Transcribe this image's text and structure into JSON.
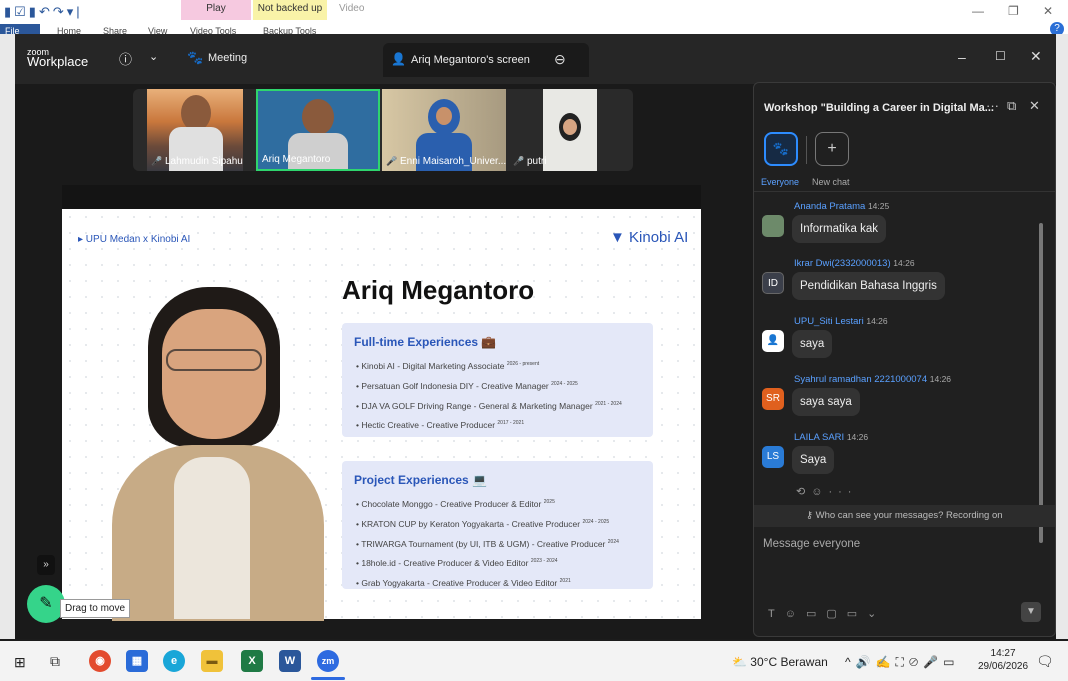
{
  "ribbon": {
    "tab_play": "Play",
    "tab_not_backed_up": "Not backed up",
    "tab_video": "Video",
    "tab_file": "File",
    "tab_home": "Home",
    "tab_share": "Share",
    "tab_view": "View",
    "tab_video_tools": "Video Tools",
    "tab_backup_tools": "Backup Tools"
  },
  "zoom": {
    "logo_small": "zoom",
    "logo_big": "Workplace",
    "meeting_label": "Meeting",
    "share_tab_label": "Ariq Megantoro's screen"
  },
  "participants": [
    {
      "name": "Lahmudin Sipahutar ..."
    },
    {
      "name": "Ariq Megantoro"
    },
    {
      "name": "Enni Maisaroh_Univer..."
    },
    {
      "name": "putri"
    }
  ],
  "slide": {
    "breadcrumb": "▸ UPU Medan x Kinobi AI",
    "brand": "Kinobi AI",
    "name": "Ariq Megantoro",
    "fulltime_title": "Full-time Experiences 💼",
    "fulltime_items": [
      {
        "text": "Kinobi AI - Digital Marketing Associate",
        "period": "2026 - present"
      },
      {
        "text": "Persatuan Golf Indonesia DIY - Creative Manager",
        "period": "2024 - 2025"
      },
      {
        "text": "DJA VA GOLF Driving Range - General & Marketing Manager",
        "period": "2021 - 2024"
      },
      {
        "text": "Hectic Creative - Creative Producer",
        "period": "2017 - 2021"
      }
    ],
    "project_title": "Project Experiences 💻",
    "project_items": [
      {
        "text": "Chocolate Monggo - Creative Producer & Editor",
        "period": "2025"
      },
      {
        "text": "KRATON CUP by Keraton Yogyakarta - Creative Producer",
        "period": "2024 - 2025"
      },
      {
        "text": "TRIWARGA Tournament (by UI, ITB & UGM) - Creative Producer",
        "period": "2024"
      },
      {
        "text": "18hole.id - Creative Producer & Video Editor",
        "period": "2023 - 2024"
      },
      {
        "text": "Grab Yogyakarta - Creative Producer & Video Editor",
        "period": "2021"
      }
    ]
  },
  "drag_tooltip": "Drag to move",
  "chat": {
    "title": "Workshop \"Building a Career in Digital Ma...",
    "tab_everyone": "Everyone",
    "tab_new_chat": "New chat",
    "messages": [
      {
        "initials": "",
        "name": "Ananda Pratama",
        "time": "14:25",
        "text": "Informatika kak",
        "color": "#6d8a6a"
      },
      {
        "initials": "ID",
        "name": "Ikrar Dwi(2332000013)",
        "time": "14:26",
        "text": "Pendidikan Bahasa Inggris",
        "color": "#3b3f4a"
      },
      {
        "initials": "",
        "name": "UPU_Siti Lestari",
        "time": "14:26",
        "text": "saya",
        "color": "#ffffff"
      },
      {
        "initials": "SR",
        "name": "Syahrul ramadhan 2221000074",
        "time": "14:26",
        "text": "saya saya",
        "color": "#e0601e"
      },
      {
        "initials": "LS",
        "name": "LAILA SARI",
        "time": "14:26",
        "text": "Saya",
        "color": "#2a7bd6"
      }
    ],
    "privacy_note": "Who can see your messages? Recording on",
    "input_placeholder": "Message everyone"
  },
  "taskbar": {
    "weather": "30°C  Berawan",
    "time": "14:27",
    "date": "29/06/2026"
  }
}
